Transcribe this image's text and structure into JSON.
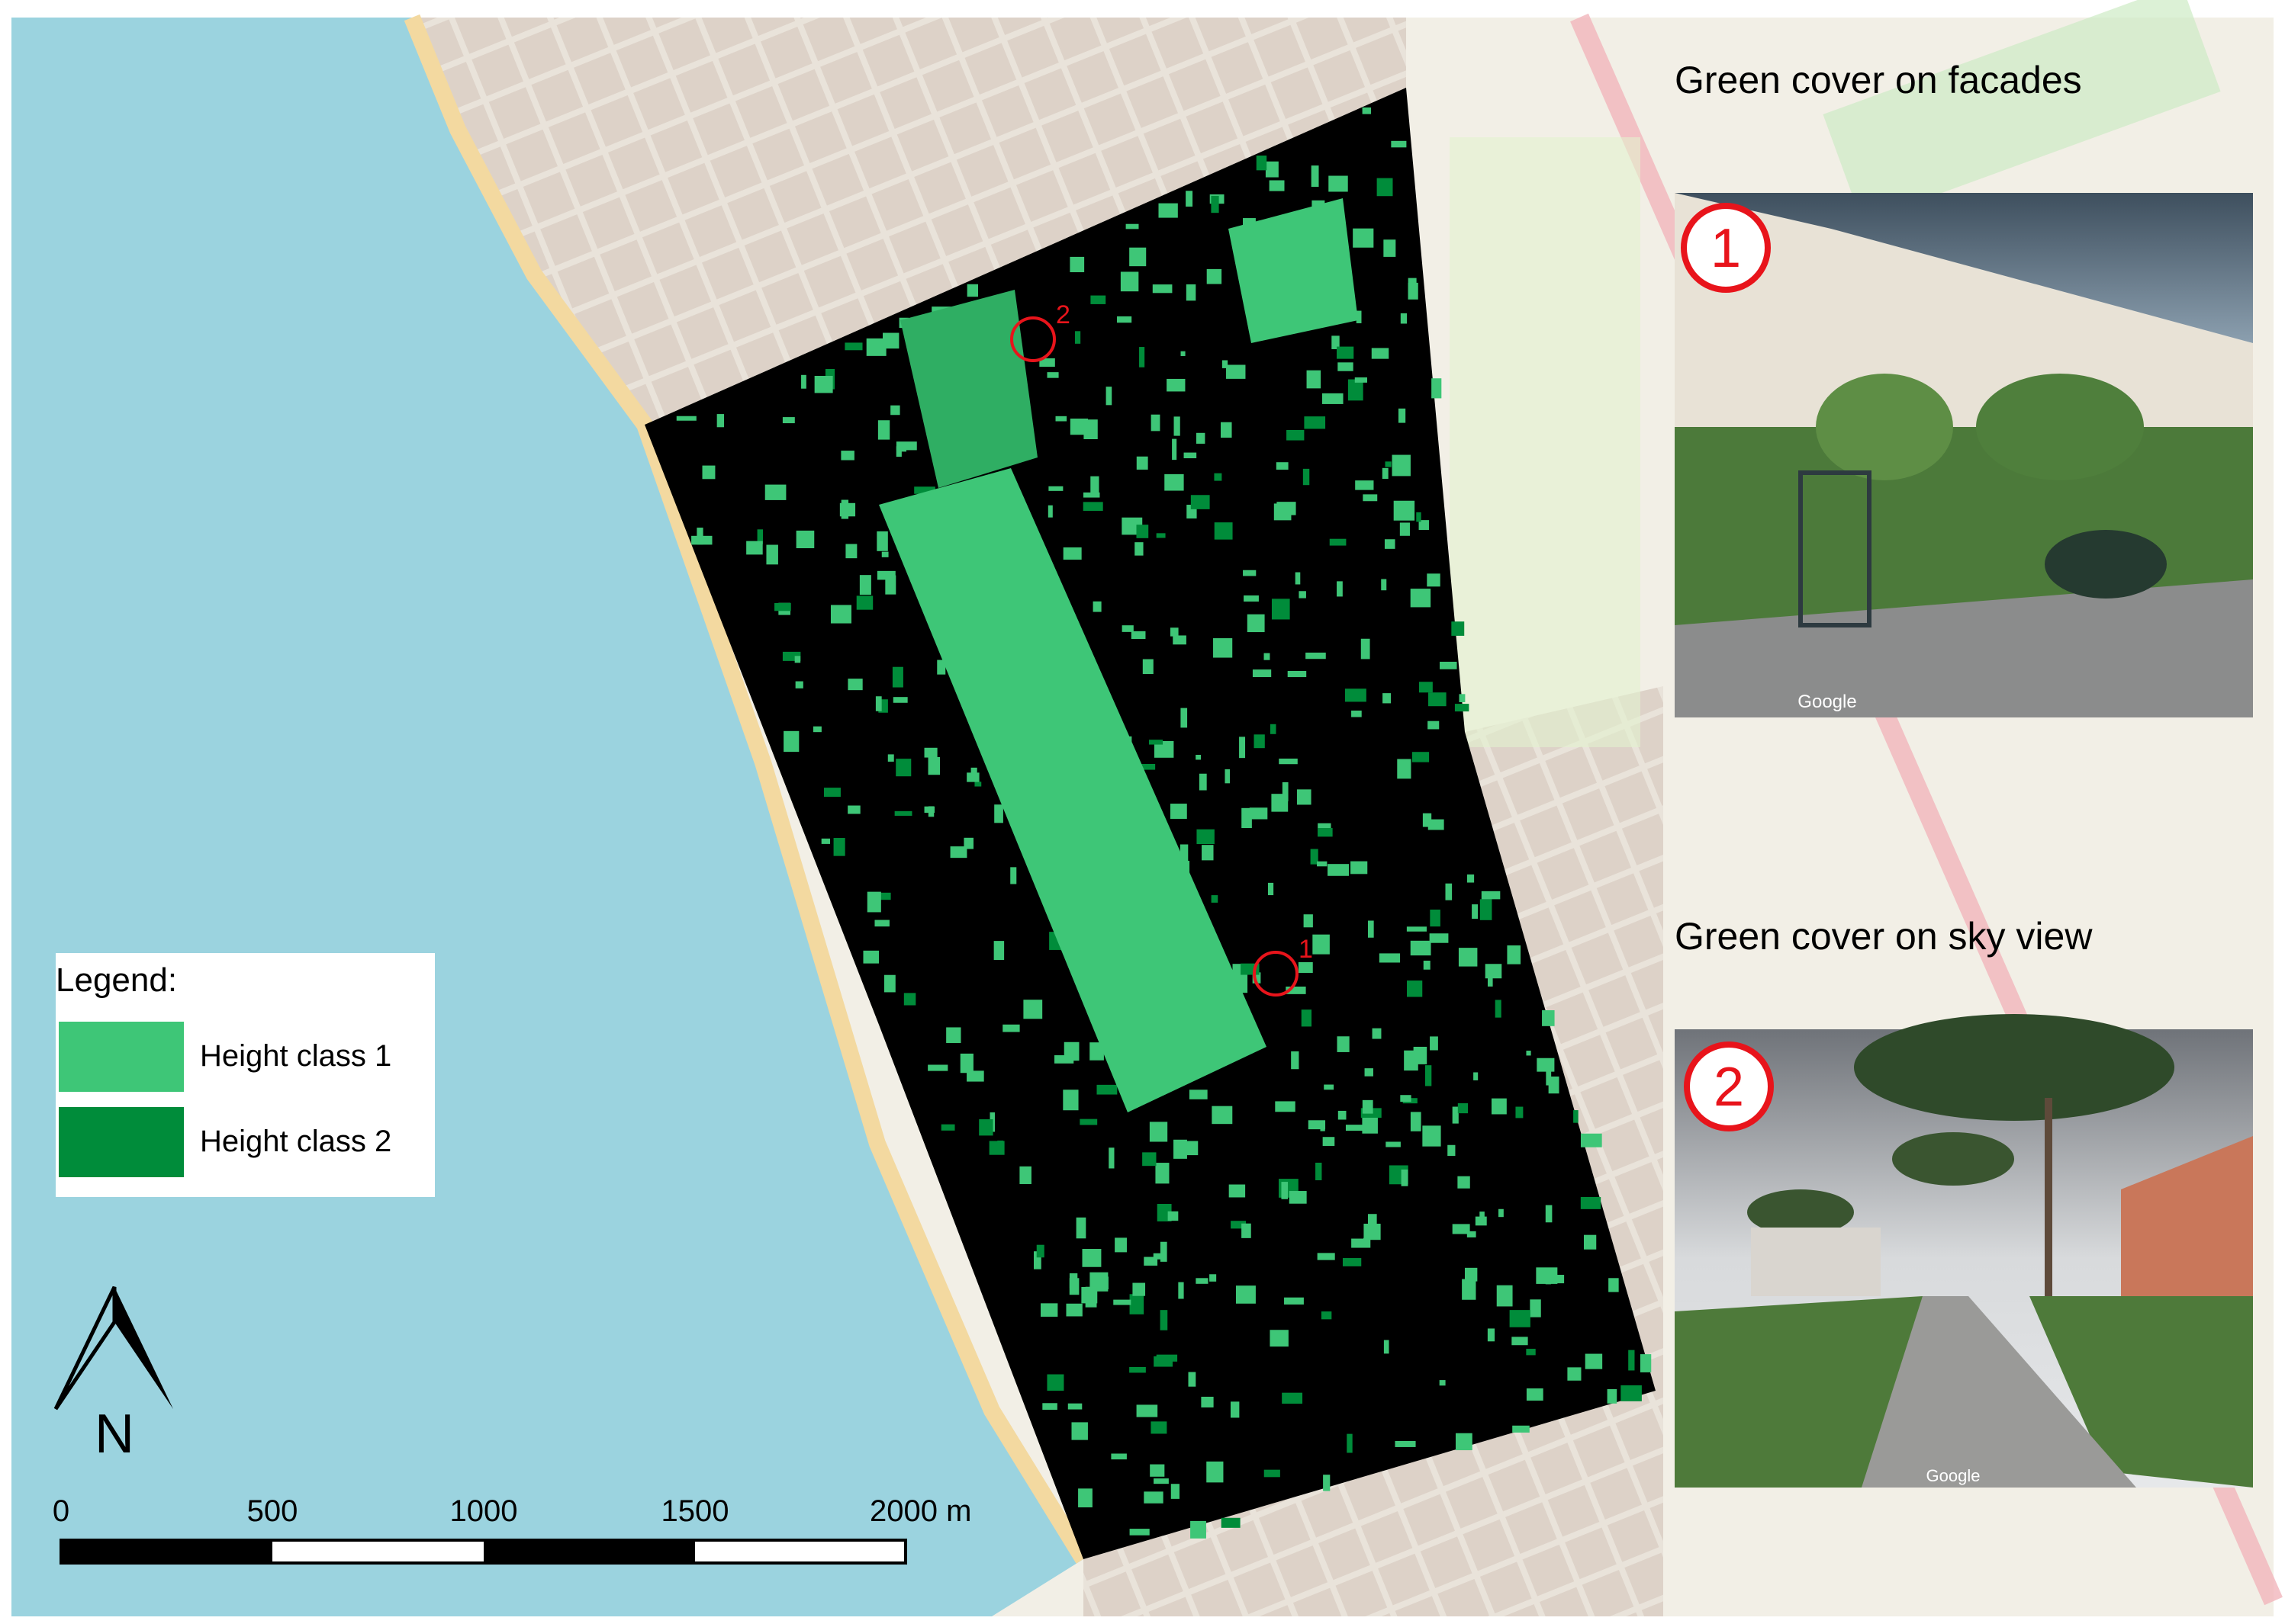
{
  "legend": {
    "title": "Legend:",
    "items": [
      {
        "label": "Height class 1",
        "color": "#3EC677"
      },
      {
        "label": "Height class 2",
        "color": "#008C3A"
      }
    ]
  },
  "north_arrow": {
    "label": "N"
  },
  "scale_bar": {
    "labels": [
      "0",
      "500",
      "1000",
      "1500",
      "2000 m"
    ]
  },
  "panels": [
    {
      "title": "Green cover on facades",
      "number": "1",
      "watermark": "Google"
    },
    {
      "title": "Green cover on sky view",
      "number": "2",
      "watermark": "Google"
    }
  ],
  "markers": [
    {
      "label": "1"
    },
    {
      "label": "2"
    }
  ],
  "colors": {
    "sea": "#9BD3DF",
    "land": "#F2EFE6",
    "mask": "#000000",
    "marker": "#E8141B"
  }
}
